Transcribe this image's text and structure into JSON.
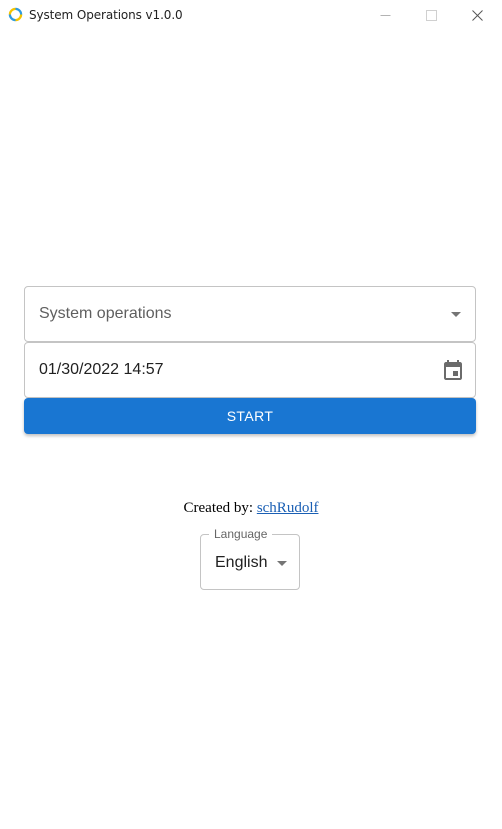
{
  "window": {
    "title": "System Operations v1.0.0"
  },
  "form": {
    "operation_select": {
      "value": "System operations"
    },
    "datetime_field": {
      "value": "01/30/2022 14:57"
    },
    "start_button": {
      "label": "START"
    }
  },
  "footer": {
    "created_by_label": "Created by:",
    "author_link": "schRudolf",
    "language": {
      "label": "Language",
      "value": "English"
    }
  },
  "icons": {
    "app": "app-logo-icon",
    "minimize": "minimize-icon",
    "maximize": "maximize-icon",
    "close": "close-icon",
    "dropdown": "chevron-down-icon",
    "calendar": "calendar-icon"
  },
  "colors": {
    "accent": "#1976d2",
    "link": "#1a5fb4",
    "border": "#c4c4c4"
  }
}
